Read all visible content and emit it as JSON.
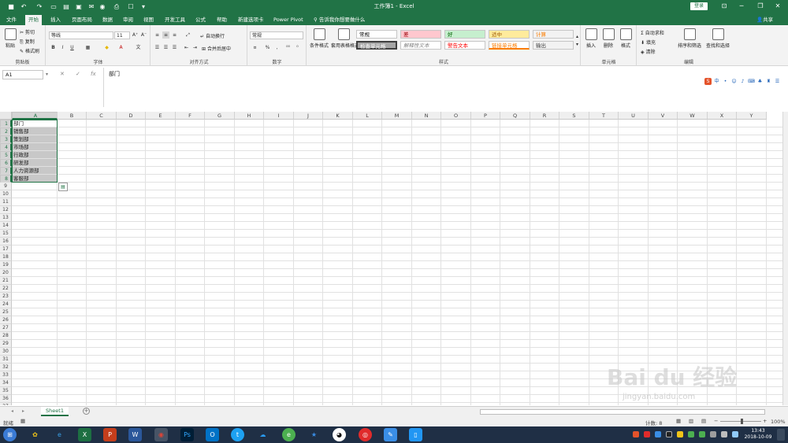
{
  "title": "工作簿1 - Excel",
  "login_label": "登录",
  "share_label": "共享",
  "tabs": [
    "文件",
    "开始",
    "插入",
    "页面布局",
    "数据",
    "审阅",
    "视图",
    "开发工具",
    "公式",
    "帮助",
    "新建选项卡",
    "Power Pivot"
  ],
  "active_tab": "开始",
  "tell_me": "告诉我你想要做什么",
  "clipboard": {
    "paste": "粘贴",
    "cut": "剪切",
    "copy": "复制",
    "format_painter": "格式刷",
    "label": "剪贴板"
  },
  "font": {
    "name": "等线",
    "size": "11",
    "bold": "B",
    "italic": "I",
    "underline": "U",
    "label": "字体"
  },
  "alignment": {
    "wrap": "自动换行",
    "merge": "合并后居中",
    "label": "对齐方式"
  },
  "number": {
    "format": "常规",
    "percent": "%",
    "comma": ",",
    "label": "数字"
  },
  "styles": {
    "conditional": "条件格式",
    "table": "套用表格格式",
    "cells": [
      {
        "text": "常规",
        "bg": "#ffffff",
        "fg": "#000000"
      },
      {
        "text": "差",
        "bg": "#ffc7ce",
        "fg": "#9c0006"
      },
      {
        "text": "好",
        "bg": "#c6efce",
        "fg": "#006100"
      },
      {
        "text": "适中",
        "bg": "#ffeb9c",
        "fg": "#9c5700"
      },
      {
        "text": "计算",
        "bg": "#f2f2f2",
        "fg": "#fa7d00"
      },
      {
        "text": "检查单元格",
        "bg": "#a5a5a5",
        "fg": "#ffffff"
      },
      {
        "text": "解释性文本",
        "bg": "#ffffff",
        "fg": "#7f7f7f"
      },
      {
        "text": "警告文本",
        "bg": "#ffffff",
        "fg": "#ff0000"
      },
      {
        "text": "链接单元格",
        "bg": "#ffffff",
        "fg": "#fa7d00"
      },
      {
        "text": "输出",
        "bg": "#f2f2f2",
        "fg": "#3f3f3f"
      }
    ],
    "label": "样式"
  },
  "cells_group": {
    "insert": "插入",
    "delete": "删除",
    "format": "格式",
    "label": "单元格"
  },
  "editing": {
    "autosum": "自动求和",
    "fill": "填充",
    "clear": "清除",
    "sort": "排序和筛选",
    "find": "查找和选择",
    "label": "编辑"
  },
  "name_box": "A1",
  "formula_value": "部门",
  "columns": [
    "A",
    "B",
    "C",
    "D",
    "E",
    "F",
    "G",
    "H",
    "I",
    "J",
    "K",
    "L",
    "M",
    "N",
    "O",
    "P",
    "Q",
    "R",
    "S",
    "T",
    "U",
    "V",
    "W",
    "X",
    "Y"
  ],
  "rows": [
    "1",
    "2",
    "3",
    "4",
    "5",
    "6",
    "7",
    "8",
    "9",
    "10",
    "11",
    "12",
    "13",
    "14",
    "15",
    "16",
    "17",
    "18",
    "19",
    "20",
    "21",
    "22",
    "23",
    "24",
    "25",
    "26",
    "27",
    "28",
    "29",
    "30",
    "31",
    "32",
    "33",
    "34",
    "35",
    "36",
    "37"
  ],
  "cell_values": [
    "部门",
    "销售部",
    "策划部",
    "市场部",
    "行政部",
    "研发部",
    "人力资源部",
    "客服部"
  ],
  "sheet_tab": "Sheet1",
  "status": {
    "ready": "就绪",
    "count_label": "计数: 8",
    "zoom": "100%"
  },
  "clock": {
    "time": "13:43",
    "date": "2018-10-09"
  },
  "watermark": {
    "brand": "Bai du 经验",
    "url": "jingyan.baidu.com"
  },
  "colors": {
    "accent": "#217346",
    "selection": "#c8c8c8",
    "taskbar": "#1f2f45"
  }
}
